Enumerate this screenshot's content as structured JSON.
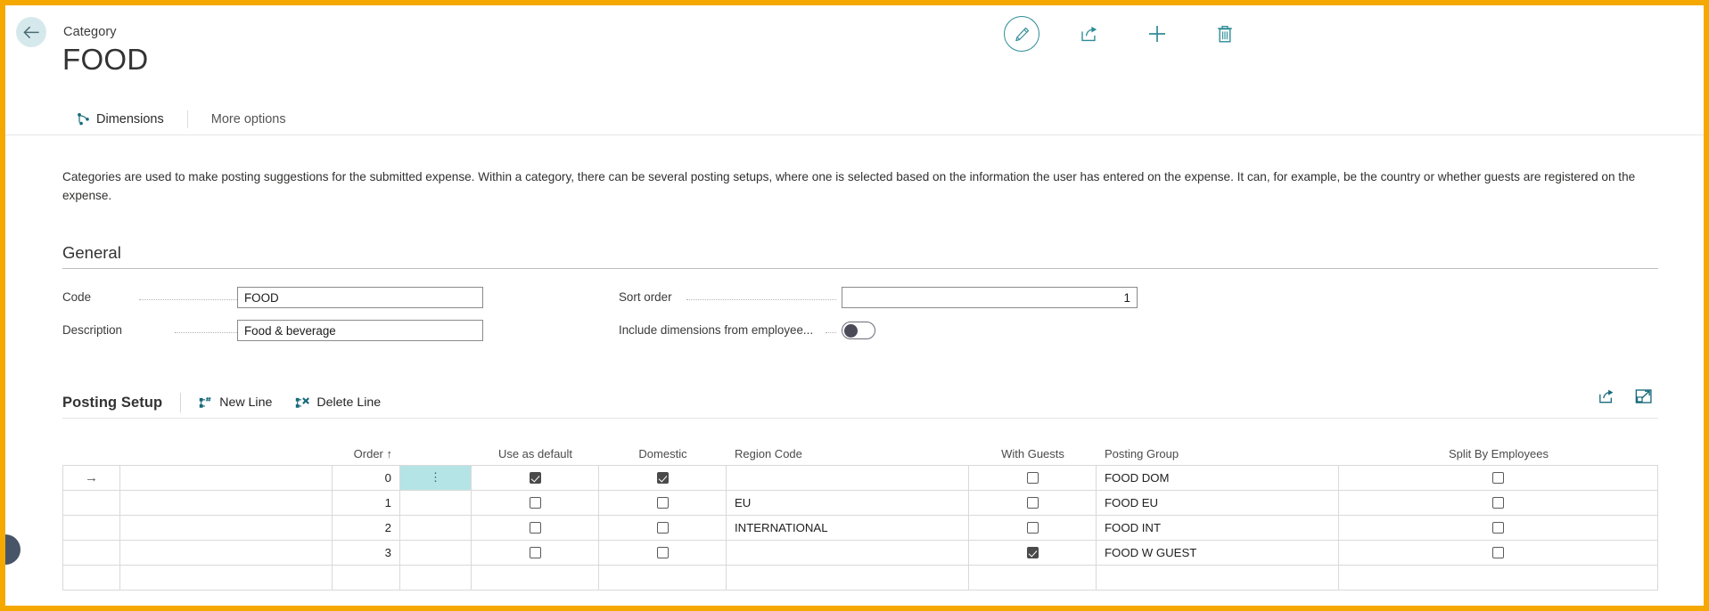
{
  "header": {
    "breadcrumb": "Category",
    "title": "FOOD",
    "back_icon": "back-arrow-icon",
    "actions": [
      {
        "name": "edit-button",
        "icon": "pencil-icon",
        "label": "Edit"
      },
      {
        "name": "share-button",
        "icon": "share-icon",
        "label": "Share"
      },
      {
        "name": "new-button",
        "icon": "plus-icon",
        "label": "New"
      },
      {
        "name": "delete-button",
        "icon": "trash-icon",
        "label": "Delete"
      }
    ]
  },
  "tabs": [
    {
      "label": "Dimensions",
      "icon": "dimensions-icon",
      "active": true
    },
    {
      "label": "More options",
      "icon": "",
      "active": false
    }
  ],
  "intro": "Categories are used to make posting suggestions for the submitted expense. Within a category, there can be several posting setups, where one is selected based on the information the user has entered on the expense. It can, for example, be the country or whether guests are registered on the expense.",
  "general": {
    "section_title": "General",
    "code": {
      "label": "Code",
      "value": "FOOD"
    },
    "description": {
      "label": "Description",
      "value": "Food & beverage"
    },
    "sort_order": {
      "label": "Sort order",
      "value": "1"
    },
    "include_dimensions": {
      "label": "Include dimensions from employee...",
      "value": "off"
    }
  },
  "posting_setup": {
    "title": "Posting Setup",
    "new_line_label": "New Line",
    "delete_line_label": "Delete Line",
    "share_icon": "share-icon",
    "expand_icon": "open-in-new-window-icon",
    "columns": [
      "",
      "",
      "Order ↑",
      "",
      "Use as default",
      "Domestic",
      "Region Code",
      "With Guests",
      "Posting Group",
      "Split By Employees"
    ],
    "headers": {
      "order": "Order ↑",
      "use_as_default": "Use as default",
      "domestic": "Domestic",
      "region_code": "Region Code",
      "with_guests": "With Guests",
      "posting_group": "Posting Group",
      "split_by_employees": "Split By Employees"
    },
    "rows": [
      {
        "selected": true,
        "indicator": "→",
        "order": "0",
        "use_as_default": true,
        "domestic": true,
        "region_code": "",
        "with_guests": false,
        "posting_group": "FOOD DOM",
        "split_by_employees": false
      },
      {
        "selected": false,
        "indicator": "",
        "order": "1",
        "use_as_default": false,
        "domestic": false,
        "region_code": "EU",
        "with_guests": false,
        "posting_group": "FOOD EU",
        "split_by_employees": false
      },
      {
        "selected": false,
        "indicator": "",
        "order": "2",
        "use_as_default": false,
        "domestic": false,
        "region_code": "INTERNATIONAL",
        "with_guests": false,
        "posting_group": "FOOD INT",
        "split_by_employees": false
      },
      {
        "selected": false,
        "indicator": "",
        "order": "3",
        "use_as_default": false,
        "domestic": false,
        "region_code": "",
        "with_guests": true,
        "posting_group": "FOOD W GUEST",
        "split_by_employees": false
      },
      {
        "selected": false,
        "indicator": "",
        "order": "",
        "use_as_default": null,
        "domestic": null,
        "region_code": "",
        "with_guests": null,
        "posting_group": "",
        "split_by_employees": null
      }
    ]
  },
  "colors": {
    "frame_border": "#f5a800",
    "accent_teal": "#16697a",
    "selection_teal": "#b5e4e6",
    "back_btn_bg": "#d5e9ec",
    "handle": "#485467"
  }
}
